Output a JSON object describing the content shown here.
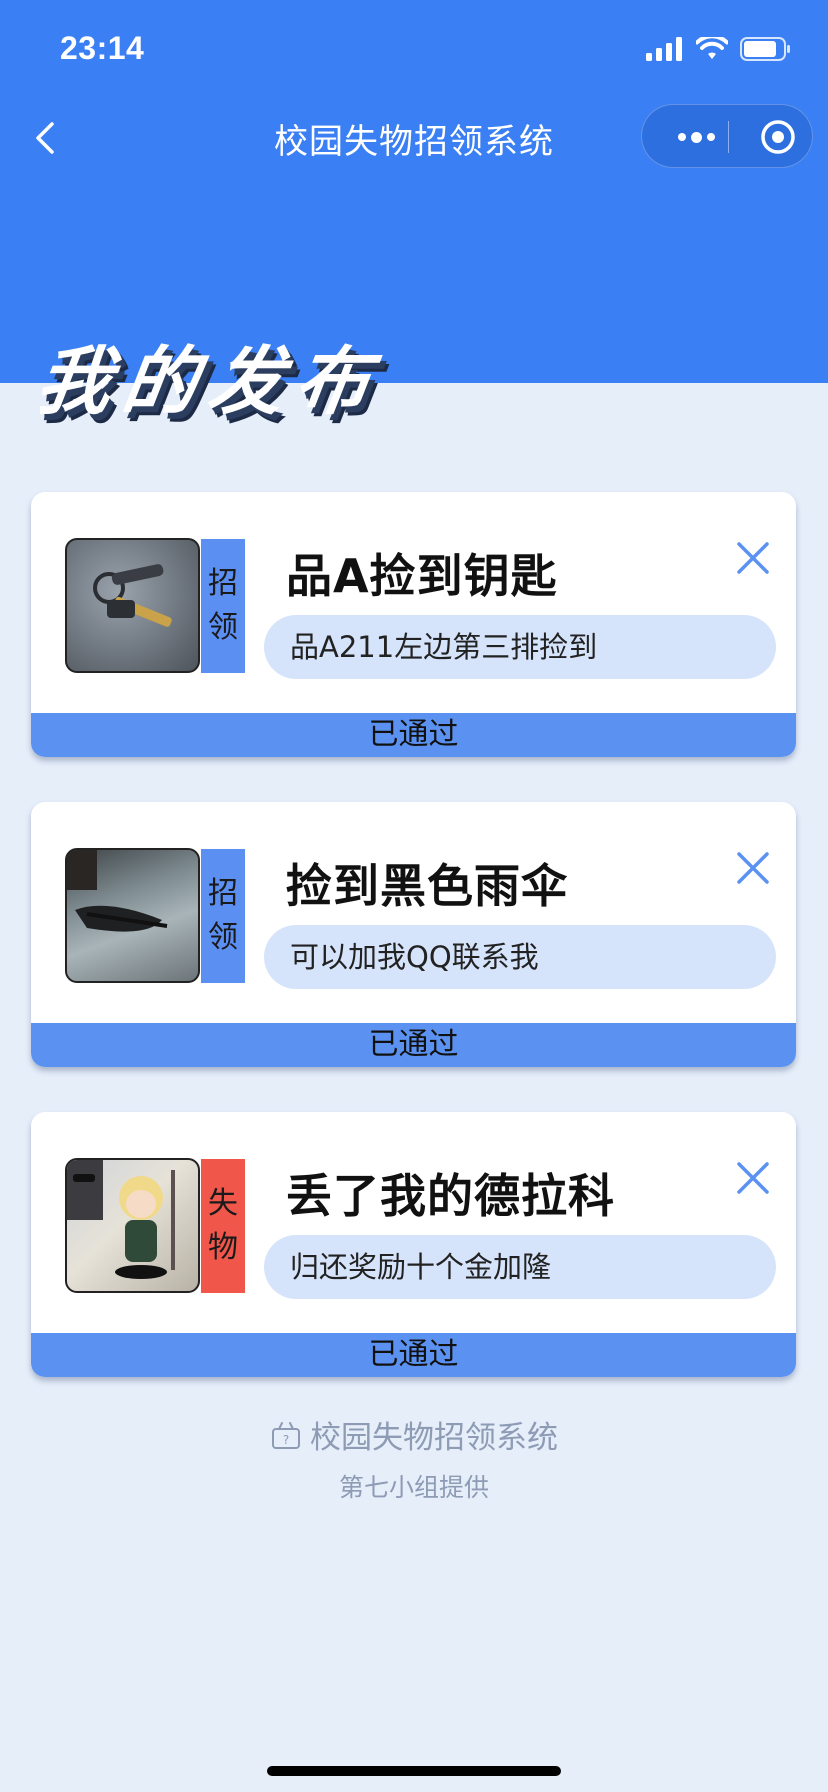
{
  "status_bar": {
    "time": "23:14"
  },
  "nav": {
    "title": "校园失物招领系统"
  },
  "page": {
    "heading": "我的发布"
  },
  "cards": [
    {
      "tag_chars": [
        "招",
        "领"
      ],
      "title": "品A捡到钥匙",
      "description": "品A211左边第三排捡到",
      "status": "已通过"
    },
    {
      "tag_chars": [
        "招",
        "领"
      ],
      "title": "捡到黑色雨伞",
      "description": "可以加我QQ联系我",
      "status": "已通过"
    },
    {
      "tag_chars": [
        "失",
        "物"
      ],
      "title": "丢了我的德拉科",
      "description": "归还奖励十个金加隆",
      "status": "已通过"
    }
  ],
  "footer": {
    "app_name": "校园失物招领系统",
    "credit": "第七小组提供"
  },
  "colors": {
    "primary": "#3a7ff3",
    "claim_tag": "#5b8ff2",
    "lost_tag": "#f0564a",
    "desc_bg": "#d6e4fb",
    "status_bar": "#5b92f1",
    "page_bg": "#e6eefa"
  }
}
